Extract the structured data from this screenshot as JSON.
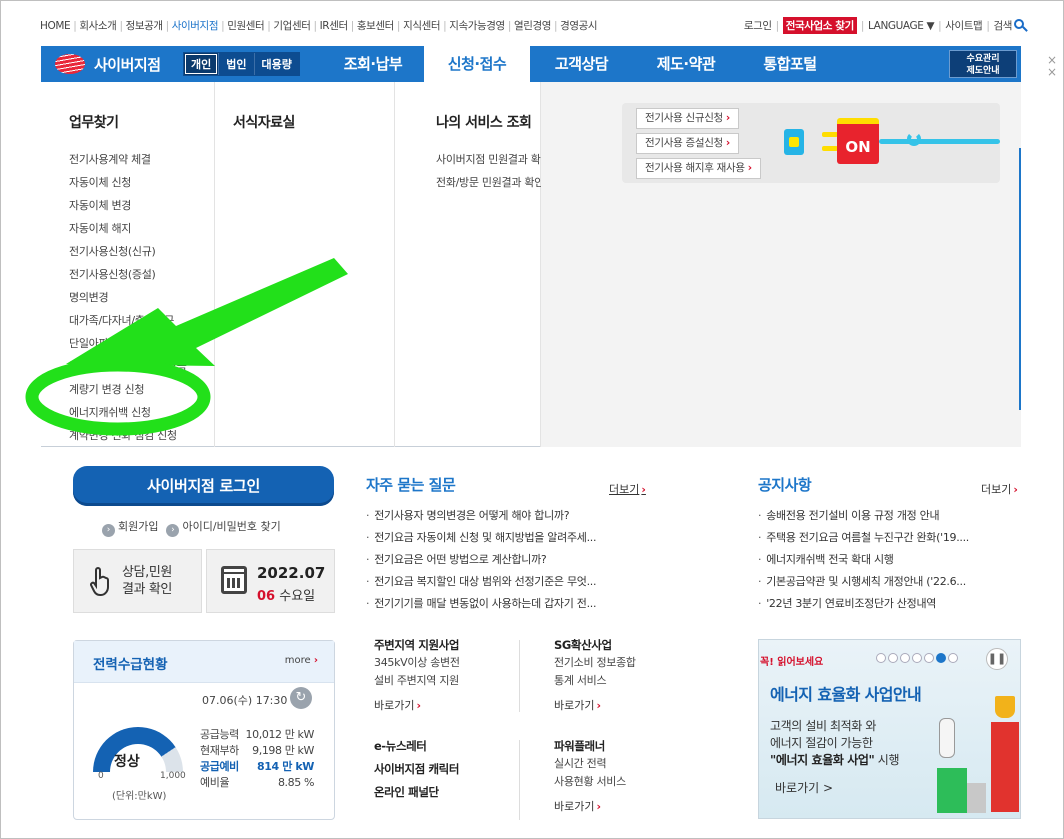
{
  "util": {
    "left": [
      "HOME",
      "회사소개",
      "정보공개",
      "사이버지점",
      "민원센터",
      "기업센터",
      "IR센터",
      "홍보센터",
      "지식센터",
      "지속가능경영",
      "열린경영",
      "경영공시"
    ],
    "active_index": 3,
    "login": "로그인",
    "find_office": "전국사업소 찾기",
    "language": "LANGUAGE",
    "sitemap": "사이트맵",
    "search": "검색"
  },
  "gnb": {
    "brand": "사이버지점",
    "segments": [
      "개인",
      "법인",
      "대용량"
    ],
    "active_segment": 0,
    "menu": [
      "조회·납부",
      "신청·접수",
      "고객상담",
      "제도·약관",
      "통합포털"
    ],
    "active_menu": 1,
    "demand_line1": "수요관리",
    "demand_line2": "제도안내"
  },
  "mega": {
    "col1_title": "업무찾기",
    "col1_items": [
      "전기사용계약 체결",
      "자동이체 신청",
      "자동이체 변경",
      "자동이체 해지",
      "전기사용신청(신규)",
      "전기사용신청(증설)",
      "명의변경",
      "대가족/다자녀/출산가구",
      "단일아파트 호별 사용량 제출",
      "종합계약 아파트 전환 요금",
      "계량기 변경 신청",
      "에너지캐쉬백 신청",
      "계약변경 전화 점검 신청"
    ],
    "col2_title": "서식자료실",
    "col3_title": "나의 서비스 조회",
    "col3_items": [
      "사이버지점 민원결과 확인",
      "전화/방문 민원결과 확인"
    ],
    "promo_buttons": [
      "전기사용 신규신청",
      "전기사용 증설신청",
      "전기사용 해지후 재사용"
    ],
    "promo_on": "ON"
  },
  "login": {
    "button": "사이버지점 로그인",
    "join": "회원가입",
    "find": "아이디/비밀번호 찾기",
    "consult_line1": "상담,민원",
    "consult_line2": "결과 확인",
    "date": "2022.07",
    "day_num": "06",
    "day_name": "수요일"
  },
  "power": {
    "title": "전력수급현황",
    "more": "more",
    "time": "07.06(수) 17:30",
    "status": "정상",
    "gauge_min": "0",
    "gauge_max": "1,000",
    "unit": "(단위:만kW)",
    "rows": [
      {
        "label": "공급능력",
        "value": "10,012 만 kW"
      },
      {
        "label": "현재부하",
        "value": "9,198 만 kW"
      },
      {
        "label": "공급예비",
        "value": "814 만 kW"
      },
      {
        "label": "예비율",
        "value": "8.85 %"
      }
    ],
    "gauge_fraction": 0.814
  },
  "faq": {
    "title": "자주 묻는 질문",
    "more": "더보기",
    "items": [
      "전기사용자 명의변경은 어떻게 해야 합니까?",
      "전기요금 자동이체 신청 및 해지방법을 알려주세...",
      "전기요금은 어떤 방법으로 계산합니까?",
      "전기요금 복지할인 대상 범위와 선정기준은 무엇...",
      "전기기기를 매달 변동없이 사용하는데 갑자기 전..."
    ]
  },
  "notice": {
    "title": "공지사항",
    "more": "더보기",
    "items": [
      "송배전용 전기설비 이용 규정 개정 안내",
      "주택용 전기요금 여름철 누진구간 완화('19....",
      "에너지캐쉬백 전국 확대 시행",
      "기본공급약관 및 시행세칙 개정안내 ('22.6...",
      "'22년 3분기 연료비조정단가 산정내역"
    ]
  },
  "services": {
    "s1_title": "주변지역 지원사업",
    "s1_desc1": "345kV이상 송변전",
    "s1_desc2": "설비 주변지역 지원",
    "s1_go": "바로가기",
    "s2_title": "SG확산사업",
    "s2_desc1": "전기소비 정보종합",
    "s2_desc2": "통계 서비스",
    "s2_go": "바로가기",
    "s3_line1": "e-뉴스레터",
    "s3_line2": "사이버지점 캐릭터",
    "s3_line3": "온라인 패널단",
    "s4_title": "파워플래너",
    "s4_desc1": "실시간 전력",
    "s4_desc2": "사용현황 서비스",
    "s4_go": "바로가기"
  },
  "banner": {
    "tag": "꼭! 읽어보세요",
    "title": "에너지 효율화 사업안내",
    "desc1": "고객의 설비 최적화 와",
    "desc2": "에너지 절감이 가능한",
    "desc3_bold": "\"에너지 효율화 사업\"",
    "desc3_rest": " 시행",
    "go": "바로가기 >"
  },
  "colors": {
    "primary": "#1d76c9",
    "accent_red": "#d5102c",
    "annotation_green": "#22e01a"
  }
}
